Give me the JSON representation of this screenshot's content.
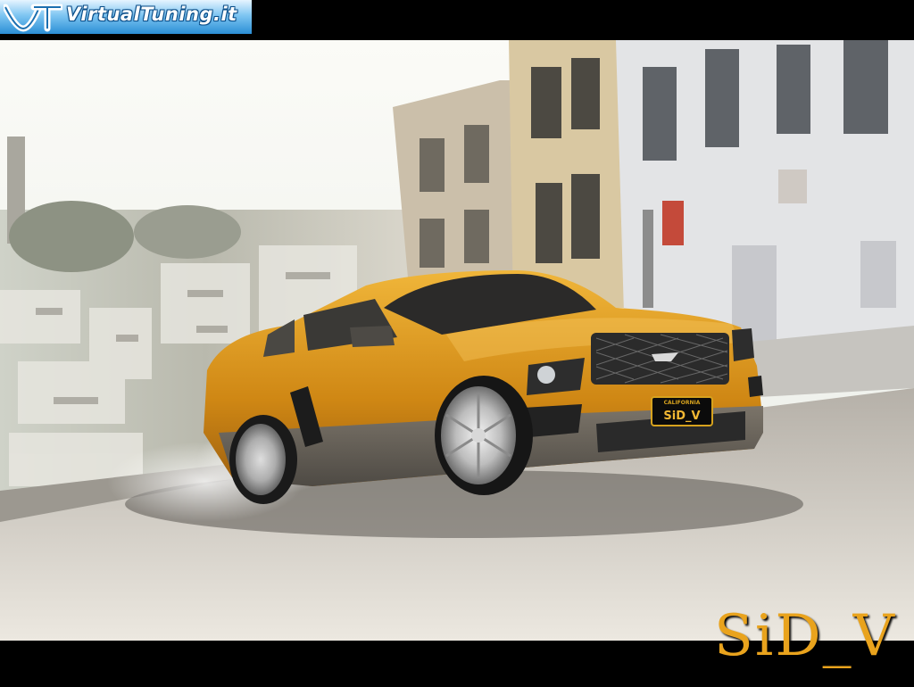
{
  "logo": {
    "text": "VirtualTuning.it"
  },
  "plate": {
    "state": "CALIFORNIA",
    "number": "SiD_V"
  },
  "signature": "SiD_V",
  "colors": {
    "accent": "#e9a31d",
    "car_body": "#d8961c",
    "banner": "#2b8fd6"
  }
}
